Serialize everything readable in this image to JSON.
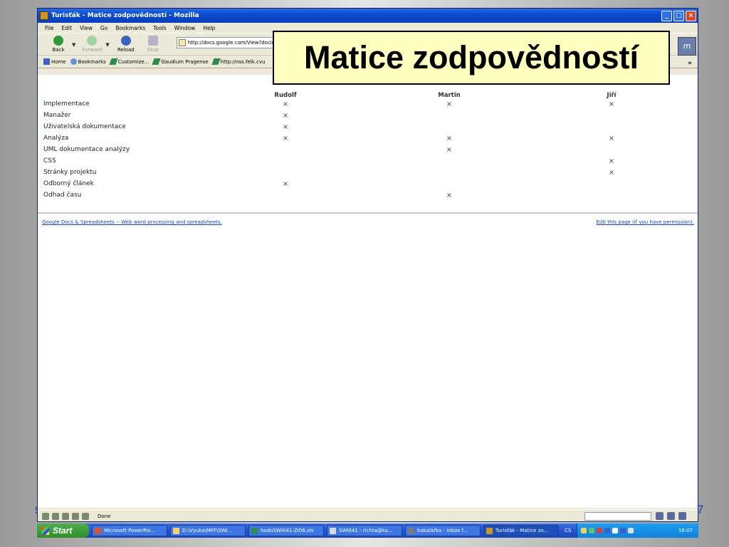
{
  "slide": {
    "title": "Matice zodpovědností",
    "number": "7",
    "number_left": "5"
  },
  "window": {
    "title": "Turisťák - Matice zodpovědností - Mozilla",
    "menu": [
      "File",
      "Edit",
      "View",
      "Go",
      "Bookmarks",
      "Tools",
      "Window",
      "Help"
    ],
    "toolbar": {
      "back": "Back",
      "forward": "Forward",
      "reload": "Reload",
      "stop": "Stop",
      "url": "http://docs.google.com/View?docid=dcw"
    },
    "bookmarks": [
      "Home",
      "Bookmarks",
      "Customize...",
      "Gaudium Pragense",
      "http://nss.felk.cvu"
    ],
    "bookmarks_more": "»",
    "status": "Done"
  },
  "matrix": {
    "columns": [
      "Rudolf",
      "Martin",
      "Jiří"
    ],
    "mark_symbol": "×",
    "rows": [
      {
        "label": "Implementace",
        "marks": [
          true,
          true,
          true
        ]
      },
      {
        "label": "Manažer",
        "marks": [
          true,
          false,
          false
        ]
      },
      {
        "label": "Uživatelská dokumentace",
        "marks": [
          true,
          false,
          false
        ]
      },
      {
        "label": "Analýza",
        "marks": [
          true,
          true,
          true
        ]
      },
      {
        "label": "UML dokumentace analýzy",
        "marks": [
          false,
          true,
          false
        ]
      },
      {
        "label": "CSS",
        "marks": [
          false,
          false,
          true
        ]
      },
      {
        "label": "Stránky projektu",
        "marks": [
          false,
          false,
          true
        ]
      },
      {
        "label": "Odborný článek",
        "marks": [
          true,
          false,
          false
        ]
      },
      {
        "label": "Odhad času",
        "marks": [
          false,
          true,
          false
        ]
      }
    ]
  },
  "footer": {
    "left_link": "Google Docs & Spreadsheets -- Web word processing and spreadsheets.",
    "right_link": "Edit this page (if you have permission)."
  },
  "taskbar": {
    "start": "Start",
    "tasks": [
      "Microsoft PowerPoi...",
      "D:\\Vyuka\\MFF\\SWI...",
      "hodnSWI041-ZI06.xls",
      "SWI041 - richta@ko...",
      "bakalářka - Inbox f...",
      "Turisťák - Matice zo..."
    ],
    "active_task_index": 5,
    "lang": "CS",
    "clock": "16:07"
  }
}
